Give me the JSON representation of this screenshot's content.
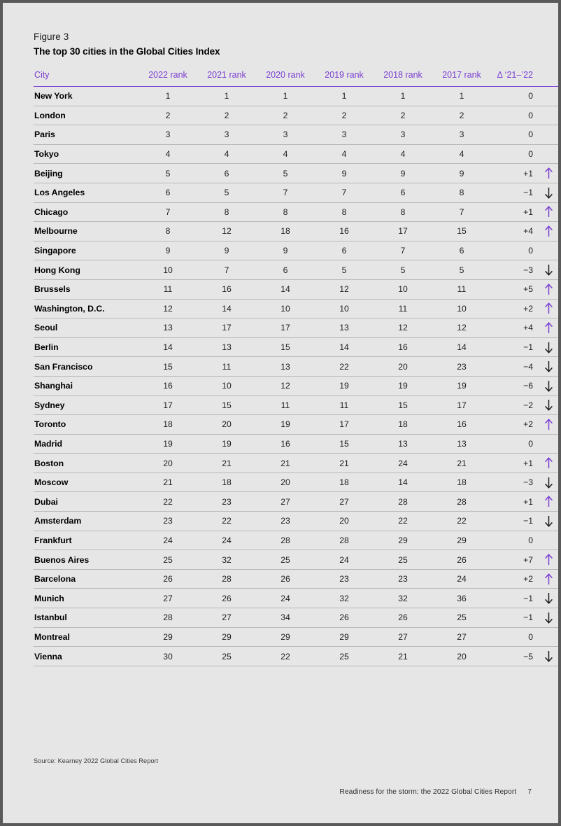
{
  "figure": {
    "label": "Figure 3",
    "title": "The top 30 cities in the Global Cities Index"
  },
  "colors": {
    "accent_purple": "#7a3fd1",
    "page_background": "#e6e6e6",
    "text": "#1d1d1d",
    "rule": "#b9b9b9",
    "arrow_up": "#7a3fd1",
    "arrow_down": "#1d1d1d"
  },
  "table": {
    "headers": [
      "City",
      "2022 rank",
      "2021 rank",
      "2020 rank",
      "2019 rank",
      "2018 rank",
      "2017 rank",
      "Δ ‘21–’22"
    ],
    "rows": [
      {
        "city": "New York",
        "r2022": "1",
        "r2021": "1",
        "r2020": "1",
        "r2019": "1",
        "r2018": "1",
        "r2017": "1",
        "delta": "0",
        "dir": "none"
      },
      {
        "city": "London",
        "r2022": "2",
        "r2021": "2",
        "r2020": "2",
        "r2019": "2",
        "r2018": "2",
        "r2017": "2",
        "delta": "0",
        "dir": "none"
      },
      {
        "city": "Paris",
        "r2022": "3",
        "r2021": "3",
        "r2020": "3",
        "r2019": "3",
        "r2018": "3",
        "r2017": "3",
        "delta": "0",
        "dir": "none"
      },
      {
        "city": "Tokyo",
        "r2022": "4",
        "r2021": "4",
        "r2020": "4",
        "r2019": "4",
        "r2018": "4",
        "r2017": "4",
        "delta": "0",
        "dir": "none"
      },
      {
        "city": "Beijing",
        "r2022": "5",
        "r2021": "6",
        "r2020": "5",
        "r2019": "9",
        "r2018": "9",
        "r2017": "9",
        "delta": "+1",
        "dir": "up"
      },
      {
        "city": "Los Angeles",
        "r2022": "6",
        "r2021": "5",
        "r2020": "7",
        "r2019": "7",
        "r2018": "6",
        "r2017": "8",
        "delta": "−1",
        "dir": "down"
      },
      {
        "city": "Chicago",
        "r2022": "7",
        "r2021": "8",
        "r2020": "8",
        "r2019": "8",
        "r2018": "8",
        "r2017": "7",
        "delta": "+1",
        "dir": "up"
      },
      {
        "city": "Melbourne",
        "r2022": "8",
        "r2021": "12",
        "r2020": "18",
        "r2019": "16",
        "r2018": "17",
        "r2017": "15",
        "delta": "+4",
        "dir": "up"
      },
      {
        "city": "Singapore",
        "r2022": "9",
        "r2021": "9",
        "r2020": "9",
        "r2019": "6",
        "r2018": "7",
        "r2017": "6",
        "delta": "0",
        "dir": "none"
      },
      {
        "city": "Hong Kong",
        "r2022": "10",
        "r2021": "7",
        "r2020": "6",
        "r2019": "5",
        "r2018": "5",
        "r2017": "5",
        "delta": "−3",
        "dir": "down"
      },
      {
        "city": "Brussels",
        "r2022": "11",
        "r2021": "16",
        "r2020": "14",
        "r2019": "12",
        "r2018": "10",
        "r2017": "11",
        "delta": "+5",
        "dir": "up"
      },
      {
        "city": "Washington, D.C.",
        "r2022": "12",
        "r2021": "14",
        "r2020": "10",
        "r2019": "10",
        "r2018": "11",
        "r2017": "10",
        "delta": "+2",
        "dir": "up"
      },
      {
        "city": "Seoul",
        "r2022": "13",
        "r2021": "17",
        "r2020": "17",
        "r2019": "13",
        "r2018": "12",
        "r2017": "12",
        "delta": "+4",
        "dir": "up"
      },
      {
        "city": "Berlin",
        "r2022": "14",
        "r2021": "13",
        "r2020": "15",
        "r2019": "14",
        "r2018": "16",
        "r2017": "14",
        "delta": "−1",
        "dir": "down"
      },
      {
        "city": "San Francisco",
        "r2022": "15",
        "r2021": "11",
        "r2020": "13",
        "r2019": "22",
        "r2018": "20",
        "r2017": "23",
        "delta": "−4",
        "dir": "down"
      },
      {
        "city": "Shanghai",
        "r2022": "16",
        "r2021": "10",
        "r2020": "12",
        "r2019": "19",
        "r2018": "19",
        "r2017": "19",
        "delta": "−6",
        "dir": "down"
      },
      {
        "city": "Sydney",
        "r2022": "17",
        "r2021": "15",
        "r2020": "11",
        "r2019": "11",
        "r2018": "15",
        "r2017": "17",
        "delta": "−2",
        "dir": "down"
      },
      {
        "city": "Toronto",
        "r2022": "18",
        "r2021": "20",
        "r2020": "19",
        "r2019": "17",
        "r2018": "18",
        "r2017": "16",
        "delta": "+2",
        "dir": "up"
      },
      {
        "city": "Madrid",
        "r2022": "19",
        "r2021": "19",
        "r2020": "16",
        "r2019": "15",
        "r2018": "13",
        "r2017": "13",
        "delta": "0",
        "dir": "none"
      },
      {
        "city": "Boston",
        "r2022": "20",
        "r2021": "21",
        "r2020": "21",
        "r2019": "21",
        "r2018": "24",
        "r2017": "21",
        "delta": "+1",
        "dir": "up"
      },
      {
        "city": "Moscow",
        "r2022": "21",
        "r2021": "18",
        "r2020": "20",
        "r2019": "18",
        "r2018": "14",
        "r2017": "18",
        "delta": "−3",
        "dir": "down"
      },
      {
        "city": "Dubai",
        "r2022": "22",
        "r2021": "23",
        "r2020": "27",
        "r2019": "27",
        "r2018": "28",
        "r2017": "28",
        "delta": "+1",
        "dir": "up"
      },
      {
        "city": "Amsterdam",
        "r2022": "23",
        "r2021": "22",
        "r2020": "23",
        "r2019": "20",
        "r2018": "22",
        "r2017": "22",
        "delta": "−1",
        "dir": "down"
      },
      {
        "city": "Frankfurt",
        "r2022": "24",
        "r2021": "24",
        "r2020": "28",
        "r2019": "28",
        "r2018": "29",
        "r2017": "29",
        "delta": "0",
        "dir": "none"
      },
      {
        "city": "Buenos Aires",
        "r2022": "25",
        "r2021": "32",
        "r2020": "25",
        "r2019": "24",
        "r2018": "25",
        "r2017": "26",
        "delta": "+7",
        "dir": "up"
      },
      {
        "city": "Barcelona",
        "r2022": "26",
        "r2021": "28",
        "r2020": "26",
        "r2019": "23",
        "r2018": "23",
        "r2017": "24",
        "delta": "+2",
        "dir": "up"
      },
      {
        "city": "Munich",
        "r2022": "27",
        "r2021": "26",
        "r2020": "24",
        "r2019": "32",
        "r2018": "32",
        "r2017": "36",
        "delta": "−1",
        "dir": "down"
      },
      {
        "city": "Istanbul",
        "r2022": "28",
        "r2021": "27",
        "r2020": "34",
        "r2019": "26",
        "r2018": "26",
        "r2017": "25",
        "delta": "−1",
        "dir": "down"
      },
      {
        "city": "Montreal",
        "r2022": "29",
        "r2021": "29",
        "r2020": "29",
        "r2019": "29",
        "r2018": "27",
        "r2017": "27",
        "delta": "0",
        "dir": "none"
      },
      {
        "city": "Vienna",
        "r2022": "30",
        "r2021": "25",
        "r2020": "22",
        "r2019": "25",
        "r2018": "21",
        "r2017": "20",
        "delta": "−5",
        "dir": "down"
      }
    ]
  },
  "footer": {
    "source": "Source: Kearney 2022 Global Cities Report",
    "running_title": "Readiness for the storm: the 2022 Global Cities Report",
    "page_number": "7"
  }
}
